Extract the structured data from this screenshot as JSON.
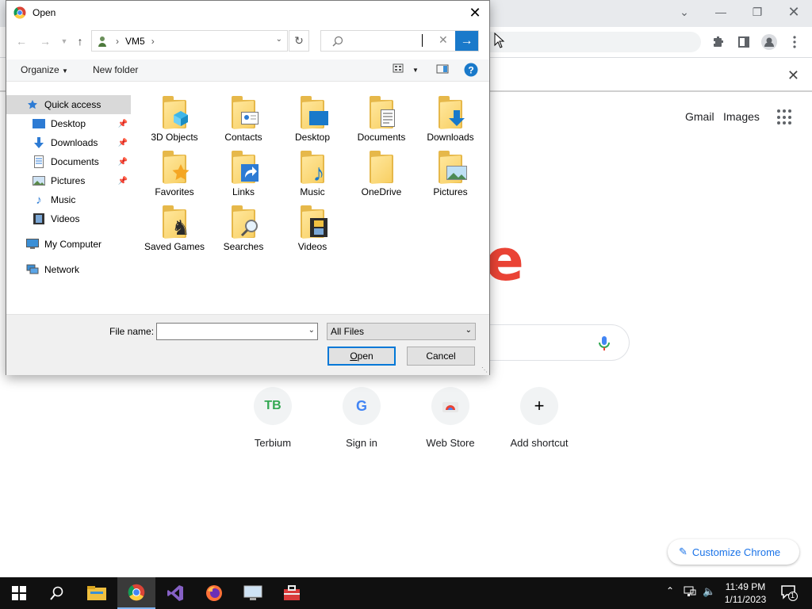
{
  "dialog": {
    "title": "Open",
    "address": {
      "segments": [
        "VM5"
      ]
    },
    "search": {
      "placeholder": ""
    },
    "commands": {
      "organize": "Organize",
      "new_folder": "New folder"
    },
    "nav": [
      {
        "label": "Quick access",
        "icon": "star-icon",
        "pinned": false,
        "selected": true
      },
      {
        "label": "Desktop",
        "icon": "desktop-icon",
        "pinned": true
      },
      {
        "label": "Downloads",
        "icon": "download-arrow-icon",
        "pinned": true
      },
      {
        "label": "Documents",
        "icon": "document-icon",
        "pinned": true
      },
      {
        "label": "Pictures",
        "icon": "picture-icon",
        "pinned": true
      },
      {
        "label": "Music",
        "icon": "music-note-icon",
        "pinned": false
      },
      {
        "label": "Videos",
        "icon": "film-icon",
        "pinned": false
      },
      {
        "label": "My Computer",
        "icon": "computer-icon",
        "pinned": false
      },
      {
        "label": "Network",
        "icon": "network-icon",
        "pinned": false
      }
    ],
    "folders": [
      {
        "label": "3D Objects",
        "overlay": "cube-icon"
      },
      {
        "label": "Contacts",
        "overlay": "contact-card-icon"
      },
      {
        "label": "Desktop",
        "overlay": "monitor-icon"
      },
      {
        "label": "Documents",
        "overlay": "document-icon"
      },
      {
        "label": "Downloads",
        "overlay": "download-arrow-icon"
      },
      {
        "label": "Favorites",
        "overlay": "star-icon"
      },
      {
        "label": "Links",
        "overlay": "shortcut-arrow-icon"
      },
      {
        "label": "Music",
        "overlay": "music-note-icon"
      },
      {
        "label": "OneDrive",
        "overlay": ""
      },
      {
        "label": "Pictures",
        "overlay": "landscape-icon"
      },
      {
        "label": "Saved Games",
        "overlay": "chess-piece-icon"
      },
      {
        "label": "Searches",
        "overlay": "magnifier-icon"
      },
      {
        "label": "Videos",
        "overlay": "film-icon"
      }
    ],
    "file_name_label": "File name:",
    "file_name_value": "",
    "file_type": "All Files",
    "open_label": "Open",
    "open_accel": "O",
    "cancel_label": "Cancel"
  },
  "chrome": {
    "top_links": {
      "gmail": "Gmail",
      "images": "Images"
    },
    "logo_fragment": "e",
    "shortcuts": [
      {
        "label": "Terbium",
        "badge": "TB",
        "badge_color": "#34a853"
      },
      {
        "label": "Sign in",
        "badge": "G",
        "badge_color": "#4285f4"
      },
      {
        "label": "Web Store",
        "badge": "",
        "badge_color": "#ea4335"
      },
      {
        "label": "Add shortcut",
        "badge": "+",
        "badge_color": "#202124"
      }
    ],
    "customize_label": "Customize Chrome",
    "accent": "#1a73e8"
  },
  "taskbar": {
    "time": "11:49 PM",
    "date": "1/11/2023",
    "notification_count": "1"
  }
}
